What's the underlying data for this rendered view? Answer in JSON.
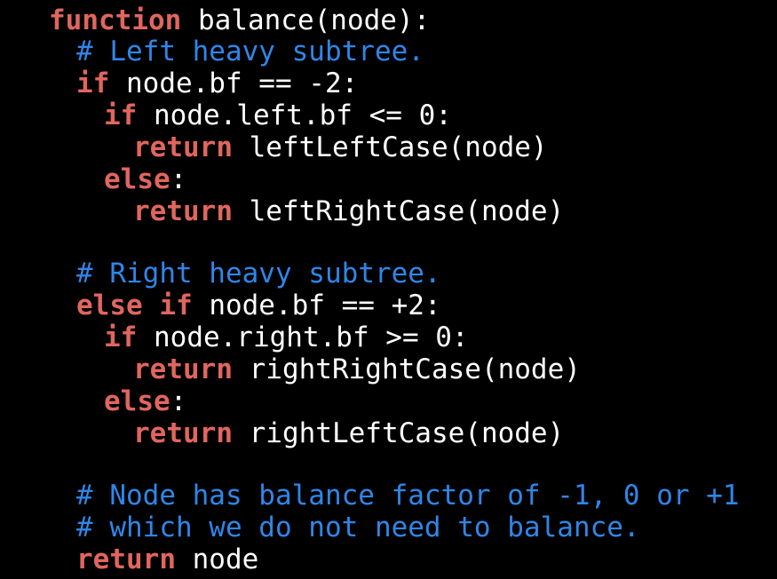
{
  "colors": {
    "background": "#000000",
    "keyword": "#e0665e",
    "comment": "#2f86e8",
    "text": "#ffffff"
  },
  "code": {
    "lines": [
      {
        "indent": 0,
        "tokens": [
          {
            "t": "kw",
            "v": "function"
          },
          {
            "t": "tx",
            "v": " balance(node):"
          }
        ]
      },
      {
        "indent": 1,
        "tokens": [
          {
            "t": "cm",
            "v": "# Left heavy subtree."
          }
        ]
      },
      {
        "indent": 1,
        "tokens": [
          {
            "t": "kw",
            "v": "if"
          },
          {
            "t": "tx",
            "v": " node.bf == -2:"
          }
        ]
      },
      {
        "indent": 2,
        "tokens": [
          {
            "t": "kw",
            "v": "if"
          },
          {
            "t": "tx",
            "v": " node.left.bf <= 0:"
          }
        ]
      },
      {
        "indent": 3,
        "tokens": [
          {
            "t": "kw",
            "v": "return"
          },
          {
            "t": "tx",
            "v": " leftLeftCase(node)"
          }
        ]
      },
      {
        "indent": 2,
        "tokens": [
          {
            "t": "kw",
            "v": "else"
          },
          {
            "t": "tx",
            "v": ":"
          }
        ]
      },
      {
        "indent": 3,
        "tokens": [
          {
            "t": "kw",
            "v": "return"
          },
          {
            "t": "tx",
            "v": " leftRightCase(node)"
          }
        ]
      },
      {
        "indent": 1,
        "tokens": [
          {
            "t": "cm",
            "v": "# Right heavy subtree."
          }
        ]
      },
      {
        "indent": 1,
        "tokens": [
          {
            "t": "kw",
            "v": "else if"
          },
          {
            "t": "tx",
            "v": " node.bf == +2:"
          }
        ]
      },
      {
        "indent": 2,
        "tokens": [
          {
            "t": "kw",
            "v": "if"
          },
          {
            "t": "tx",
            "v": " node.right.bf >= 0:"
          }
        ]
      },
      {
        "indent": 3,
        "tokens": [
          {
            "t": "kw",
            "v": "return"
          },
          {
            "t": "tx",
            "v": " rightRightCase(node)"
          }
        ]
      },
      {
        "indent": 2,
        "tokens": [
          {
            "t": "kw",
            "v": "else"
          },
          {
            "t": "tx",
            "v": ":"
          }
        ]
      },
      {
        "indent": 3,
        "tokens": [
          {
            "t": "kw",
            "v": "return"
          },
          {
            "t": "tx",
            "v": " rightLeftCase(node)"
          }
        ]
      },
      {
        "indent": 1,
        "tokens": [
          {
            "t": "cm",
            "v": "# Node has balance factor of -1, 0 or +1"
          }
        ]
      },
      {
        "indent": 1,
        "tokens": [
          {
            "t": "cm",
            "v": "# which we do not need to balance."
          }
        ]
      },
      {
        "indent": 1,
        "tokens": [
          {
            "t": "kw",
            "v": "return"
          },
          {
            "t": "tx",
            "v": " node"
          }
        ]
      }
    ]
  }
}
